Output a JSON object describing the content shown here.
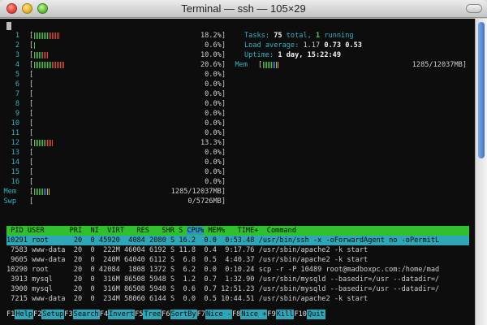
{
  "window": {
    "title": "Terminal — ssh — 105×29"
  },
  "cpu_meters": [
    {
      "num": "1",
      "pct": "18.2%",
      "level": 0.182
    },
    {
      "num": "2",
      "pct": "0.6%",
      "level": 0.006
    },
    {
      "num": "3",
      "pct": "10.0%",
      "level": 0.1
    },
    {
      "num": "4",
      "pct": "20.6%",
      "level": 0.206
    },
    {
      "num": "5",
      "pct": "0.0%",
      "level": 0
    },
    {
      "num": "6",
      "pct": "0.0%",
      "level": 0
    },
    {
      "num": "7",
      "pct": "0.0%",
      "level": 0
    },
    {
      "num": "8",
      "pct": "0.0%",
      "level": 0
    },
    {
      "num": "9",
      "pct": "0.0%",
      "level": 0
    },
    {
      "num": "10",
      "pct": "0.0%",
      "level": 0
    },
    {
      "num": "11",
      "pct": "0.0%",
      "level": 0
    },
    {
      "num": "12",
      "pct": "13.3%",
      "level": 0.133
    },
    {
      "num": "13",
      "pct": "0.0%",
      "level": 0
    },
    {
      "num": "14",
      "pct": "0.0%",
      "level": 0
    },
    {
      "num": "15",
      "pct": "0.0%",
      "level": 0
    },
    {
      "num": "16",
      "pct": "0.0%",
      "level": 0
    }
  ],
  "mem_left": {
    "label": "Mem",
    "value": "1285/12037MB",
    "level": 0.107
  },
  "swp_left": {
    "label": "Swp",
    "value": "0/5726MB",
    "level": 0
  },
  "summary": {
    "tasks_label": "Tasks: ",
    "tasks_total": "75",
    "tasks_mid": " total, ",
    "tasks_running": "1",
    "tasks_end": " running",
    "load_label": "Load average: ",
    "load_1": "1.17",
    "load_5": "0.73",
    "load_15": "0.53",
    "uptime_label": "Uptime: ",
    "uptime_value": "1 day, 15:22:49",
    "mem_label": "Mem",
    "mem_value": "1285/12037MB",
    "mem_level": 0.107
  },
  "table": {
    "header": " PID USER      PRI  NI  VIRT   RES   SHR S ",
    "sort_col": "CPU%",
    "header_rest": " MEM%   TIME+  Command",
    "rows": [
      {
        "pid": "10291",
        "user": "root    ",
        "pri": "20",
        "ni": "0",
        "virt": "45920",
        "res": "4084",
        "shr": "2080",
        "s": "S",
        "cpu": "16.2",
        "mem": "0.0",
        "time": "0:53.48",
        "cmd": "/usr/bin/ssh -x -oForwardAgent no -oPermitL",
        "selected": true
      },
      {
        "pid": "7583",
        "user": "www-data",
        "pri": "20",
        "ni": "0",
        "virt": "222M",
        "res": "46004",
        "shr": "6192",
        "s": "S",
        "cpu": "11.8",
        "mem": "0.4",
        "time": "9:17.76",
        "cmd": "/usr/sbin/apache2 -k start"
      },
      {
        "pid": "9605",
        "user": "www-data",
        "pri": "20",
        "ni": "0",
        "virt": "240M",
        "res": "64040",
        "shr": "6112",
        "s": "S",
        "cpu": "6.8",
        "mem": "0.5",
        "time": "4:40.37",
        "cmd": "/usr/sbin/apache2 -k start"
      },
      {
        "pid": "10290",
        "user": "root    ",
        "pri": "20",
        "ni": "0",
        "virt": "42084",
        "res": "1808",
        "shr": "1372",
        "s": "S",
        "cpu": "6.2",
        "mem": "0.0",
        "time": "0:10.24",
        "cmd": "scp -r -P 10489 root@madboxpc.com:/home/mad"
      },
      {
        "pid": "3913",
        "user": "mysql   ",
        "pri": "20",
        "ni": "0",
        "virt": "316M",
        "res": "86508",
        "shr": "5948",
        "s": "S",
        "cpu": "1.2",
        "mem": "0.7",
        "time": "1:32.90",
        "cmd": "/usr/sbin/mysqld --basedir=/usr --datadir=/"
      },
      {
        "pid": "3900",
        "user": "mysql   ",
        "pri": "20",
        "ni": "0",
        "virt": "316M",
        "res": "86508",
        "shr": "5948",
        "s": "S",
        "cpu": "0.6",
        "mem": "0.7",
        "time": "12:51.23",
        "cmd": "/usr/sbin/mysqld --basedir=/usr --datadir=/"
      },
      {
        "pid": "7215",
        "user": "www-data",
        "pri": "20",
        "ni": "0",
        "virt": "234M",
        "res": "58060",
        "shr": "6144",
        "s": "S",
        "cpu": "0.0",
        "mem": "0.5",
        "time": "10:44.51",
        "cmd": "/usr/sbin/apache2 -k start"
      }
    ]
  },
  "fkeys": [
    {
      "key": "F1",
      "label": "Help  "
    },
    {
      "key": "F2",
      "label": "Setup "
    },
    {
      "key": "F3",
      "label": "Search"
    },
    {
      "key": "F4",
      "label": "Invert"
    },
    {
      "key": "F5",
      "label": "Tree  "
    },
    {
      "key": "F6",
      "label": "SortBy"
    },
    {
      "key": "F7",
      "label": "Nice -"
    },
    {
      "key": "F8",
      "label": "Nice +"
    },
    {
      "key": "F9",
      "label": "Kill  "
    },
    {
      "key": "F10",
      "label": "Quit  "
    }
  ],
  "colors": {
    "terminal_bg": "#0d0d0d",
    "header_green": "#2fbf2f",
    "sort_blue": "#2f95c8",
    "selected_cyan": "#2fa6b8"
  }
}
